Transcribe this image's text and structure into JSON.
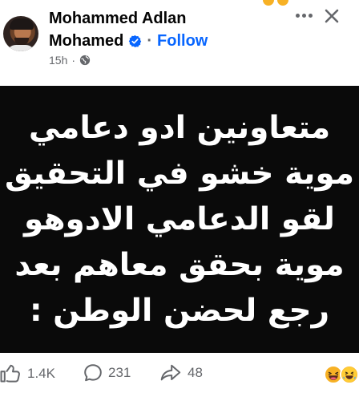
{
  "post": {
    "author_first_line": "Mohammed Adlan",
    "author_second_line": "Mohamed",
    "separator": "·",
    "follow_label": "Follow",
    "time": "15h",
    "meta_separator": "·",
    "text_lines": [
      "متعاونين ادو دعامي",
      "موية خشو في التحقيق",
      "لقو الدعامي الادوهو",
      "موية بحقق معاهم بعد",
      "رجع لحضن الوطن :"
    ]
  },
  "icons": {
    "verified": "verified-badge-icon",
    "globe": "globe-icon",
    "more": "more-options-icon",
    "close": "close-icon",
    "like": "like-icon",
    "comment": "comment-icon",
    "share": "share-icon"
  },
  "stats": {
    "likes": "1.4K",
    "comments": "231",
    "shares": "48"
  },
  "colors": {
    "accent": "#0866ff",
    "text": "#050505",
    "muted": "#65676b",
    "post_background": "#0a0a0a"
  }
}
